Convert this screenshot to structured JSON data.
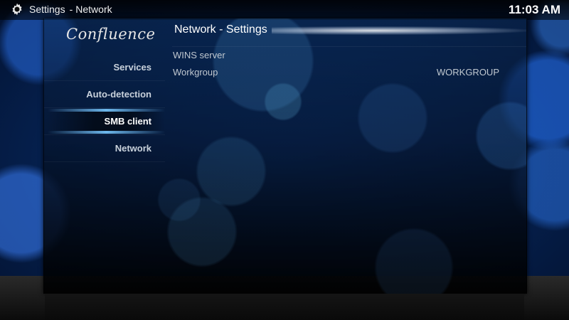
{
  "topbar": {
    "section": "Settings",
    "page": "Network",
    "clock": "11:03 AM",
    "icon": "gear-icon"
  },
  "logo": "Confluence",
  "sidebar": {
    "items": [
      {
        "label": "Services",
        "active": false
      },
      {
        "label": "Auto-detection",
        "active": false
      },
      {
        "label": "SMB client",
        "active": true
      },
      {
        "label": "Network",
        "active": false
      }
    ]
  },
  "content": {
    "title": "Network - Settings",
    "settings": [
      {
        "label": "WINS server",
        "value": ""
      },
      {
        "label": "Workgroup",
        "value": "WORKGROUP"
      }
    ]
  },
  "colors": {
    "accent": "#78c8ff",
    "background": "#062354"
  }
}
